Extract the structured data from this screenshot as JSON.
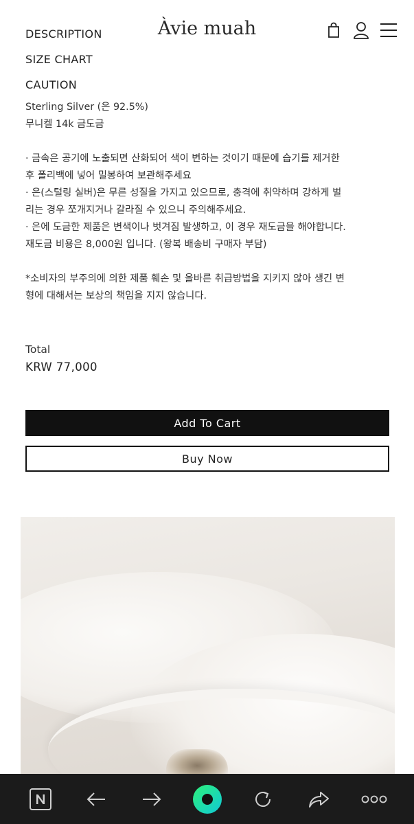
{
  "header": {
    "logo": "Àvie muah"
  },
  "tabs": [
    "DESCRIPTION",
    "SIZE CHART",
    "CAUTION"
  ],
  "caution": {
    "material_lines": [
      "Sterling Silver (은 92.5%)",
      "무니켈 14k 금도금"
    ],
    "care_lines": [
      "· 금속은 공기에 노출되면 산화되어 색이 변하는 것이기 때문에 습기를 제거한",
      "후 폴리백에 넣어 밀봉하여 보관해주세요",
      "· 은(스털링 실버)은 무른 성질을 가지고 있으므로, 충격에 취약하며 강하게 벌",
      "리는 경우 쪼개지거나 갈라질 수 있으니 주의해주세요.",
      "· 은에 도금한 제품은 변색이나 벗겨짐 발생하고, 이 경우 재도금을 해야합니다.",
      "재도금 비용은 8,000원 입니다. (왕복 배송비 구매자 부담)"
    ],
    "notice_lines": [
      "*소비자의 부주의에 의한 제품 훼손 및 올바른 취급방법을 지키지 않아 생긴 변",
      "형에 대해서는 보상의 책임을 지지 않습니다."
    ]
  },
  "total": {
    "label": "Total",
    "value": "KRW 77,000"
  },
  "buttons": {
    "add_to_cart": "Add To Cart",
    "buy_now": "Buy Now"
  },
  "icons": {
    "bag": "shopping-bag-icon",
    "user": "user-icon",
    "menu": "menu-icon",
    "home": "naver-home-icon",
    "back": "back-arrow-icon",
    "forward": "forward-arrow-icon",
    "green_dot": "green-circle-icon",
    "reload": "reload-icon",
    "share": "share-icon",
    "more": "more-icon"
  },
  "colors": {
    "bar_bg": "#1b1b1b",
    "button_black": "#111111",
    "accent_green": "#19e0a0"
  }
}
